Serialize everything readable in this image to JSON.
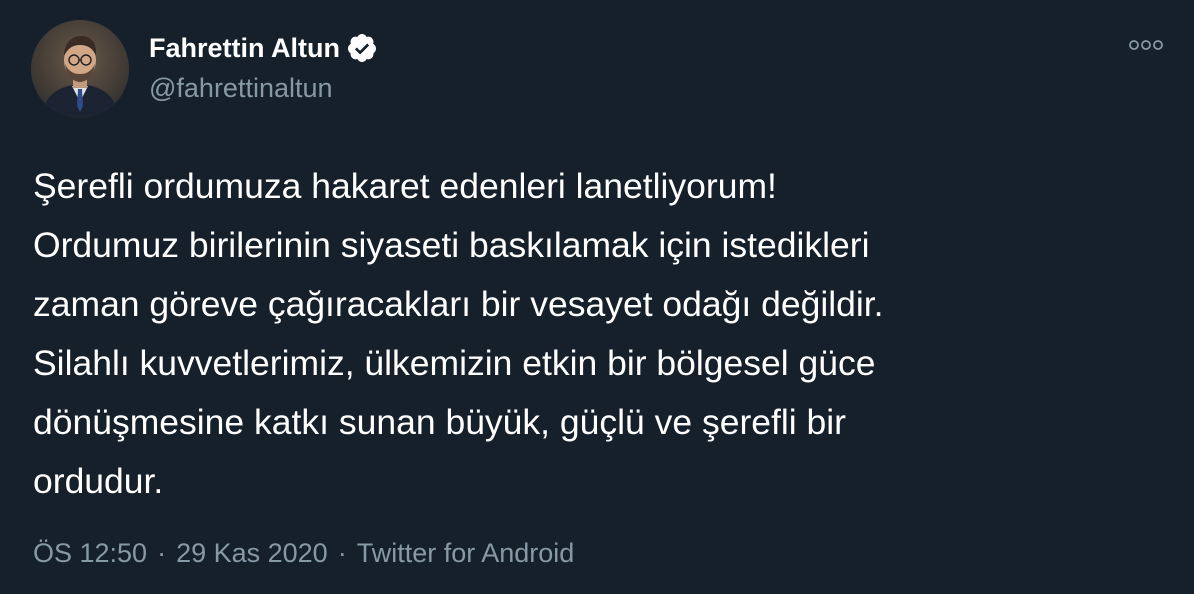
{
  "author": {
    "name": "Fahrettin Altun",
    "handle": "@fahrettinaltun",
    "verified": true,
    "avatar_icon": "profile-photo"
  },
  "more_icon": "more-horizontal-icon",
  "tweet": {
    "text": "Şerefli ordumuza hakaret edenleri lanetliyorum!\nOrdumuz birilerinin siyaseti baskılamak için istedikleri\nzaman göreve çağıracakları bir vesayet odağı değildir.\nSilahlı kuvvetlerimiz, ülkemizin etkin bir bölgesel güce\ndönüşmesine katkı sunan büyük, güçlü ve şerefli bir\nordudur."
  },
  "meta": {
    "time": "ÖS 12:50",
    "separator": "·",
    "date": "29 Kas 2020",
    "source": "Twitter for Android"
  },
  "colors": {
    "background": "#15202b",
    "text": "#ffffff",
    "secondary": "#8899a6",
    "verified_badge": "#ffffff"
  }
}
